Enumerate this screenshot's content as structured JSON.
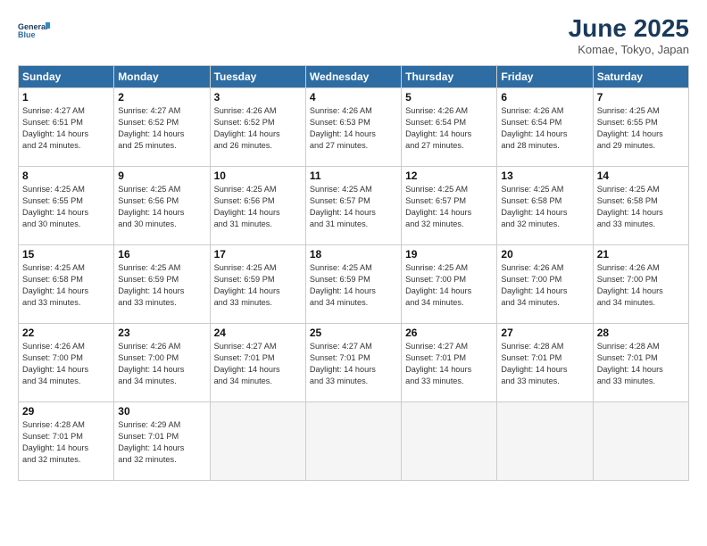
{
  "logo": {
    "line1": "General",
    "line2": "Blue"
  },
  "title": "June 2025",
  "subtitle": "Komae, Tokyo, Japan",
  "days_of_week": [
    "Sunday",
    "Monday",
    "Tuesday",
    "Wednesday",
    "Thursday",
    "Friday",
    "Saturday"
  ],
  "weeks": [
    [
      {
        "day": "1",
        "info": "Sunrise: 4:27 AM\nSunset: 6:51 PM\nDaylight: 14 hours\nand 24 minutes."
      },
      {
        "day": "2",
        "info": "Sunrise: 4:27 AM\nSunset: 6:52 PM\nDaylight: 14 hours\nand 25 minutes."
      },
      {
        "day": "3",
        "info": "Sunrise: 4:26 AM\nSunset: 6:52 PM\nDaylight: 14 hours\nand 26 minutes."
      },
      {
        "day": "4",
        "info": "Sunrise: 4:26 AM\nSunset: 6:53 PM\nDaylight: 14 hours\nand 27 minutes."
      },
      {
        "day": "5",
        "info": "Sunrise: 4:26 AM\nSunset: 6:54 PM\nDaylight: 14 hours\nand 27 minutes."
      },
      {
        "day": "6",
        "info": "Sunrise: 4:26 AM\nSunset: 6:54 PM\nDaylight: 14 hours\nand 28 minutes."
      },
      {
        "day": "7",
        "info": "Sunrise: 4:25 AM\nSunset: 6:55 PM\nDaylight: 14 hours\nand 29 minutes."
      }
    ],
    [
      {
        "day": "8",
        "info": "Sunrise: 4:25 AM\nSunset: 6:55 PM\nDaylight: 14 hours\nand 30 minutes."
      },
      {
        "day": "9",
        "info": "Sunrise: 4:25 AM\nSunset: 6:56 PM\nDaylight: 14 hours\nand 30 minutes."
      },
      {
        "day": "10",
        "info": "Sunrise: 4:25 AM\nSunset: 6:56 PM\nDaylight: 14 hours\nand 31 minutes."
      },
      {
        "day": "11",
        "info": "Sunrise: 4:25 AM\nSunset: 6:57 PM\nDaylight: 14 hours\nand 31 minutes."
      },
      {
        "day": "12",
        "info": "Sunrise: 4:25 AM\nSunset: 6:57 PM\nDaylight: 14 hours\nand 32 minutes."
      },
      {
        "day": "13",
        "info": "Sunrise: 4:25 AM\nSunset: 6:58 PM\nDaylight: 14 hours\nand 32 minutes."
      },
      {
        "day": "14",
        "info": "Sunrise: 4:25 AM\nSunset: 6:58 PM\nDaylight: 14 hours\nand 33 minutes."
      }
    ],
    [
      {
        "day": "15",
        "info": "Sunrise: 4:25 AM\nSunset: 6:58 PM\nDaylight: 14 hours\nand 33 minutes."
      },
      {
        "day": "16",
        "info": "Sunrise: 4:25 AM\nSunset: 6:59 PM\nDaylight: 14 hours\nand 33 minutes."
      },
      {
        "day": "17",
        "info": "Sunrise: 4:25 AM\nSunset: 6:59 PM\nDaylight: 14 hours\nand 33 minutes."
      },
      {
        "day": "18",
        "info": "Sunrise: 4:25 AM\nSunset: 6:59 PM\nDaylight: 14 hours\nand 34 minutes."
      },
      {
        "day": "19",
        "info": "Sunrise: 4:25 AM\nSunset: 7:00 PM\nDaylight: 14 hours\nand 34 minutes."
      },
      {
        "day": "20",
        "info": "Sunrise: 4:26 AM\nSunset: 7:00 PM\nDaylight: 14 hours\nand 34 minutes."
      },
      {
        "day": "21",
        "info": "Sunrise: 4:26 AM\nSunset: 7:00 PM\nDaylight: 14 hours\nand 34 minutes."
      }
    ],
    [
      {
        "day": "22",
        "info": "Sunrise: 4:26 AM\nSunset: 7:00 PM\nDaylight: 14 hours\nand 34 minutes."
      },
      {
        "day": "23",
        "info": "Sunrise: 4:26 AM\nSunset: 7:00 PM\nDaylight: 14 hours\nand 34 minutes."
      },
      {
        "day": "24",
        "info": "Sunrise: 4:27 AM\nSunset: 7:01 PM\nDaylight: 14 hours\nand 34 minutes."
      },
      {
        "day": "25",
        "info": "Sunrise: 4:27 AM\nSunset: 7:01 PM\nDaylight: 14 hours\nand 33 minutes."
      },
      {
        "day": "26",
        "info": "Sunrise: 4:27 AM\nSunset: 7:01 PM\nDaylight: 14 hours\nand 33 minutes."
      },
      {
        "day": "27",
        "info": "Sunrise: 4:28 AM\nSunset: 7:01 PM\nDaylight: 14 hours\nand 33 minutes."
      },
      {
        "day": "28",
        "info": "Sunrise: 4:28 AM\nSunset: 7:01 PM\nDaylight: 14 hours\nand 33 minutes."
      }
    ],
    [
      {
        "day": "29",
        "info": "Sunrise: 4:28 AM\nSunset: 7:01 PM\nDaylight: 14 hours\nand 32 minutes."
      },
      {
        "day": "30",
        "info": "Sunrise: 4:29 AM\nSunset: 7:01 PM\nDaylight: 14 hours\nand 32 minutes."
      },
      {
        "day": "",
        "info": ""
      },
      {
        "day": "",
        "info": ""
      },
      {
        "day": "",
        "info": ""
      },
      {
        "day": "",
        "info": ""
      },
      {
        "day": "",
        "info": ""
      }
    ]
  ]
}
